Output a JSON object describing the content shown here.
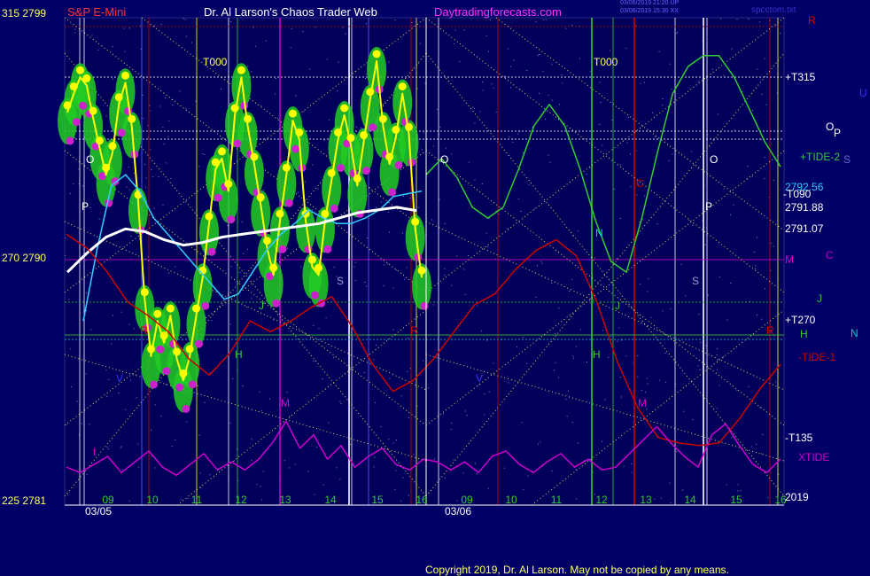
{
  "header": {
    "left_top": "315  2799",
    "instrument": "S&P E-Mini",
    "site_title": "Dr. Al Larson's Chaos Trader Web",
    "site_url": "Daytradingforecasts.com",
    "timestamp_1": "03/06/2019 21:20 UP",
    "timestamp_2": "03/06/2019 15:30 XX",
    "file_name": "spcctom.txt"
  },
  "left_axis": {
    "mid": "270  2790",
    "bottom": "225  2781"
  },
  "right_labels": [
    {
      "text": "R",
      "color": "#cc0000"
    },
    {
      "text": "+T315",
      "color": "#ffffff"
    },
    {
      "text": "U",
      "color": "#3333ff"
    },
    {
      "text": "O",
      "color": "#ffffff"
    },
    {
      "text": "P",
      "color": "#ffffff"
    },
    {
      "text": "+TIDE-2",
      "color": "#33cc33"
    },
    {
      "text": "S",
      "color": "#6666cc"
    },
    {
      "text": "2792.56",
      "color": "#33ccff"
    },
    {
      "text": "-T090",
      "color": "#ffffff"
    },
    {
      "text": "2791.88",
      "color": "#ffffff"
    },
    {
      "text": "2791.07",
      "color": "#ffffff"
    },
    {
      "text": "M",
      "color": "#cc00cc"
    },
    {
      "text": "C",
      "color": "#cc00cc"
    },
    {
      "text": "J",
      "color": "#33cc33"
    },
    {
      "text": "+T270",
      "color": "#ffffff"
    },
    {
      "text": "H",
      "color": "#33cc33"
    },
    {
      "text": "N",
      "color": "#00cccc"
    },
    {
      "text": "-TIDE-1",
      "color": "#cc0000"
    },
    {
      "text": "-T135",
      "color": "#ffffff"
    },
    {
      "text": "XTIDE",
      "color": "#cc00cc"
    },
    {
      "text": "2019",
      "color": "#ffffff"
    }
  ],
  "in_chart_labels": [
    {
      "text": "T000",
      "color": "#ffff66"
    },
    {
      "text": "T000",
      "color": "#ffff66"
    },
    {
      "text": "O",
      "color": "#ffffff"
    },
    {
      "text": "P",
      "color": "#ffffff"
    },
    {
      "text": "O",
      "color": "#ffffff"
    },
    {
      "text": "P",
      "color": "#ffffff"
    },
    {
      "text": "O",
      "color": "#ffffff"
    },
    {
      "text": "S",
      "color": "#9999cc"
    },
    {
      "text": "S",
      "color": "#9999cc"
    },
    {
      "text": "N",
      "color": "#00cccc"
    },
    {
      "text": "C",
      "color": "#cc0000"
    },
    {
      "text": "H",
      "color": "#33cc33"
    },
    {
      "text": "H",
      "color": "#33cc33"
    },
    {
      "text": "J",
      "color": "#33cc33"
    },
    {
      "text": "J",
      "color": "#33cc33"
    },
    {
      "text": "R",
      "color": "#cc0000"
    },
    {
      "text": "R",
      "color": "#cc0000"
    },
    {
      "text": "R",
      "color": "#cc0000"
    },
    {
      "text": "M",
      "color": "#cc00cc"
    },
    {
      "text": "M",
      "color": "#cc00cc"
    },
    {
      "text": "t",
      "color": "#cc00cc"
    },
    {
      "text": "V",
      "color": "#3333ff"
    },
    {
      "text": "V",
      "color": "#3333ff"
    }
  ],
  "footer": {
    "date_1": "03/05",
    "date_2": "03/06",
    "copyright": "Copyright 2019, Dr. Al Larson. May not be copied by any means."
  },
  "chart_data": {
    "type": "line",
    "title": "S&P E-Mini",
    "y_axis_labels": [
      "2799",
      "2790",
      "2781"
    ],
    "angle_labels": [
      "315",
      "270",
      "225"
    ],
    "ylim": [
      2781,
      2799
    ],
    "annotations_price": [
      "2792.56",
      "2791.88",
      "2791.07"
    ],
    "x_ticks_day1": [
      "09",
      "10",
      "11",
      "12",
      "13",
      "14",
      "15",
      "16"
    ],
    "x_ticks_day2": [
      "09",
      "10",
      "11",
      "12",
      "13",
      "14",
      "15",
      "16"
    ],
    "dates": [
      "03/05",
      "03/06"
    ],
    "series": [
      {
        "color": "#ffff00",
        "values": [
          2795.5,
          2796.2,
          2796.8,
          2796.5,
          2795.3,
          2794.2,
          2793.2,
          2794.0,
          2795.8,
          2796.6,
          2795.0,
          2792.2,
          2788.6,
          2786.5,
          2787.8,
          2787.0,
          2788.0,
          2786.4,
          2785.6,
          2786.5,
          2788.0,
          2789.4,
          2791.4,
          2793.4,
          2793.8,
          2792.6,
          2795.4,
          2796.8,
          2795.0,
          2793.6,
          2792.1,
          2790.5,
          2789.5,
          2791.5,
          2793.2,
          2795.2,
          2794.5,
          2791.5,
          2789.8,
          2789.5,
          2791.5,
          2793.0,
          2794.5,
          2795.4,
          2794.3,
          2792.8,
          2794.4,
          2796.0,
          2797.4,
          2795.0,
          2793.6,
          2794.6,
          2796.2,
          2794.7,
          2791.2,
          2789.4
        ]
      },
      {
        "color": "#33ccff",
        "values": [
          2787.8,
          2790.5,
          2792.8,
          2793.2,
          2792.6,
          2791.6,
          2791.0,
          2790.4,
          2789.8,
          2789.2,
          2788.6,
          2788.8,
          2789.6,
          2790.4,
          2791.0,
          2791.4,
          2791.9,
          2791.6,
          2791.4,
          2791.4,
          2791.6,
          2791.9,
          2792.4,
          2792.5,
          2792.6
        ]
      },
      {
        "color": "#ffffff",
        "values": [
          2789.6,
          2790.3,
          2790.9,
          2791.2,
          2791.1,
          2790.8,
          2790.6,
          2790.7,
          2790.9,
          2791.0,
          2791.1,
          2791.2,
          2791.3,
          2791.4,
          2791.6,
          2791.8,
          2791.9,
          2792.0,
          2791.88
        ]
      },
      {
        "color": "#33cc33",
        "name": "+TIDE-2",
        "values": [
          2793.2,
          2793.8,
          2793.1,
          2792.0,
          2791.6,
          2792.0,
          2793.4,
          2795.0,
          2795.8,
          2795.0,
          2793.4,
          2791.5,
          2790.0,
          2789.6,
          2791.6,
          2794.0,
          2796.2,
          2797.2,
          2797.6,
          2797.6,
          2796.8,
          2795.6,
          2794.4,
          2793.5
        ]
      },
      {
        "color": "#cc0000",
        "name": "-TIDE-1",
        "values": [
          2791.0,
          2790.5,
          2789.6,
          2788.5,
          2788.0,
          2787.4,
          2786.4,
          2785.8,
          2786.6,
          2787.8,
          2787.4,
          2787.8,
          2788.3,
          2788.7,
          2787.6,
          2786.2,
          2785.2,
          2785.6,
          2786.4,
          2787.4,
          2788.4,
          2788.8,
          2789.7,
          2790.4,
          2790.8,
          2790.2,
          2788.5,
          2786.3,
          2784.6,
          2783.5,
          2783.3,
          2783.2,
          2783.3,
          2784.2,
          2785.3,
          2786.2
        ]
      },
      {
        "color": "#cc00cc",
        "name": "XTIDE",
        "values": [
          2782.4,
          2782.2,
          2782.5,
          2782.8,
          2782.2,
          2782.6,
          2783.0,
          2782.4,
          2782.1,
          2782.5,
          2782.9,
          2782.3,
          2782.6,
          2782.3,
          2782.7,
          2783.3,
          2784.1,
          2783.1,
          2783.6,
          2782.7,
          2783.2,
          2782.4,
          2782.8,
          2783.1,
          2782.5,
          2782.3,
          2782.7,
          2782.6,
          2782.3,
          2782.6,
          2782.2,
          2782.8,
          2783.0,
          2782.5,
          2782.2,
          2782.6,
          2782.9,
          2782.4,
          2782.7,
          2782.3,
          2782.4,
          2782.9,
          2783.4,
          2783.9,
          2783.3,
          2782.8,
          2782.4,
          2783.6,
          2784.0,
          2783.2,
          2782.5,
          2782.2,
          2782.7
        ]
      }
    ]
  }
}
